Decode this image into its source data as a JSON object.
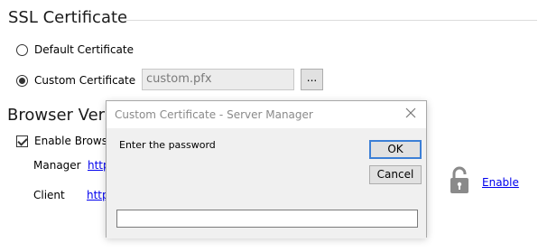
{
  "ssl": {
    "title": "SSL Certificate",
    "default_label": "Default Certificate",
    "custom_label": "Custom Certificate",
    "selected": "custom",
    "custom_file": "custom.pfx",
    "browse_label": "..."
  },
  "browser": {
    "title": "Browser Versions",
    "enable_label": "Enable Browser",
    "enabled": true,
    "manager_label": "Manager",
    "manager_link": "http",
    "client_label": "Client",
    "client_link": "http",
    "lock_link": "Enable",
    "icons": {
      "lock": "padlock-icon"
    }
  },
  "dialog": {
    "title": "Custom Certificate - Server Manager",
    "prompt": "Enter the password",
    "ok_label": "OK",
    "cancel_label": "Cancel",
    "password_value": "",
    "icons": {
      "close": "close-icon"
    }
  }
}
